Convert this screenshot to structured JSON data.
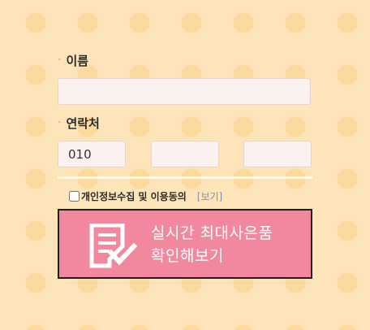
{
  "form": {
    "name": {
      "bullet": "·",
      "label": "이름",
      "value": "",
      "placeholder": ""
    },
    "contact": {
      "bullet": "·",
      "label": "연락처",
      "parts": [
        {
          "value": "010"
        },
        {
          "value": ""
        },
        {
          "value": ""
        }
      ]
    },
    "consent": {
      "checked": false,
      "label": "개인정보수집 및 이용동의",
      "view_link": "[보기]"
    },
    "submit": {
      "line1": "실시간 최대사은품",
      "line2": "확인해보기",
      "icon": "document-check-icon"
    }
  },
  "colors": {
    "background": "#fde4b9",
    "dot": "#fcd99c",
    "button": "#f1889e",
    "bullet": "#f08a8a",
    "link": "#7b8fb8",
    "input_bg": "#fbf1f1"
  }
}
